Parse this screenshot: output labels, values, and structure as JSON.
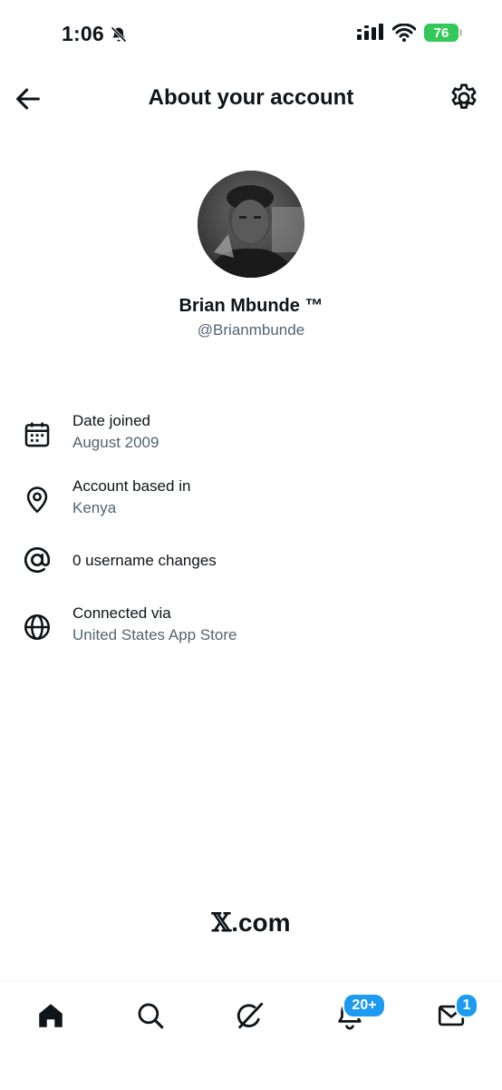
{
  "status_bar": {
    "time": "1:06",
    "battery": "76"
  },
  "header": {
    "title": "About your account",
    "back_icon": "arrow-left-icon",
    "settings_icon": "gear-icon"
  },
  "profile": {
    "name": "Brian Mbunde ™",
    "handle": "@Brianmbunde"
  },
  "info": [
    {
      "icon": "calendar-icon",
      "label": "Date joined",
      "value": "August 2009"
    },
    {
      "icon": "location-pin-icon",
      "label": "Account based in",
      "value": "Kenya"
    },
    {
      "icon": "at-sign-icon",
      "label": "0 username changes",
      "value": ""
    },
    {
      "icon": "globe-icon",
      "label": "Connected via",
      "value": "United States App Store"
    }
  ],
  "footer": {
    "logo_x": "𝕏",
    "logo_text": ".com"
  },
  "bottom_nav": {
    "items": [
      "home-icon",
      "search-icon",
      "grok-icon",
      "notifications-icon",
      "messages-icon"
    ],
    "notifications_badge": "20+",
    "messages_badge": "1",
    "accent": "#1d9bf0"
  }
}
